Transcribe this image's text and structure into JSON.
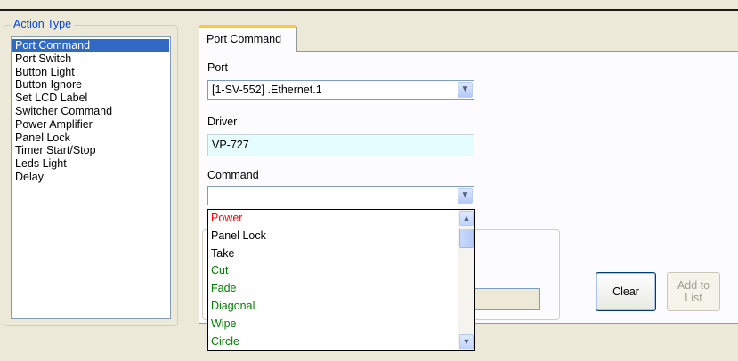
{
  "action_type": {
    "title": "Action Type",
    "items": [
      {
        "label": "Port Command",
        "selected": true
      },
      {
        "label": "Port Switch"
      },
      {
        "label": "Button Light"
      },
      {
        "label": "Button Ignore"
      },
      {
        "label": "Set LCD Label"
      },
      {
        "label": "Switcher Command"
      },
      {
        "label": "Power Amplifier"
      },
      {
        "label": "Panel Lock"
      },
      {
        "label": "Timer Start/Stop"
      },
      {
        "label": "Leds Light"
      },
      {
        "label": "Delay"
      }
    ]
  },
  "tab": {
    "label": "Port Command"
  },
  "form": {
    "port_label": "Port",
    "port_value": "[1-SV-552] .Ethernet.1",
    "driver_label": "Driver",
    "driver_value": "VP-727",
    "command_label": "Command",
    "command_value": ""
  },
  "command_dropdown": {
    "items": [
      {
        "label": "Power",
        "color": "#ff0000"
      },
      {
        "label": "Panel Lock",
        "color": "#000000"
      },
      {
        "label": "Take",
        "color": "#000000"
      },
      {
        "label": "Cut",
        "color": "#008000"
      },
      {
        "label": "Fade",
        "color": "#008000"
      },
      {
        "label": "Diagonal",
        "color": "#008000"
      },
      {
        "label": "Wipe",
        "color": "#008000"
      },
      {
        "label": "Circle",
        "color": "#008000"
      }
    ]
  },
  "buttons": {
    "clear": "Clear",
    "add_to_list": "Add to List"
  },
  "colors": {
    "selection": "#316ac5",
    "group_title": "#0046d5",
    "tab_accent": "#ffc83c"
  }
}
